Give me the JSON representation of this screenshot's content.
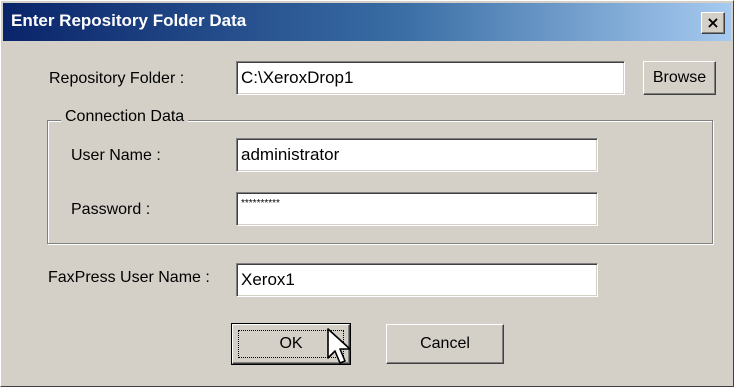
{
  "window": {
    "title": "Enter Repository Folder Data",
    "close_glyph": "×"
  },
  "repository": {
    "label": "Repository Folder :",
    "value": "C:\\XeroxDrop1",
    "browse_label": "Browse"
  },
  "connection": {
    "group_label": "Connection Data",
    "username_label": "User Name :",
    "username_value": "administrator",
    "password_label": "Password :",
    "password_value": "**********"
  },
  "faxpress": {
    "label": "FaxPress User Name :",
    "value": "Xerox1"
  },
  "buttons": {
    "ok_label": "OK",
    "cancel_label": "Cancel"
  }
}
